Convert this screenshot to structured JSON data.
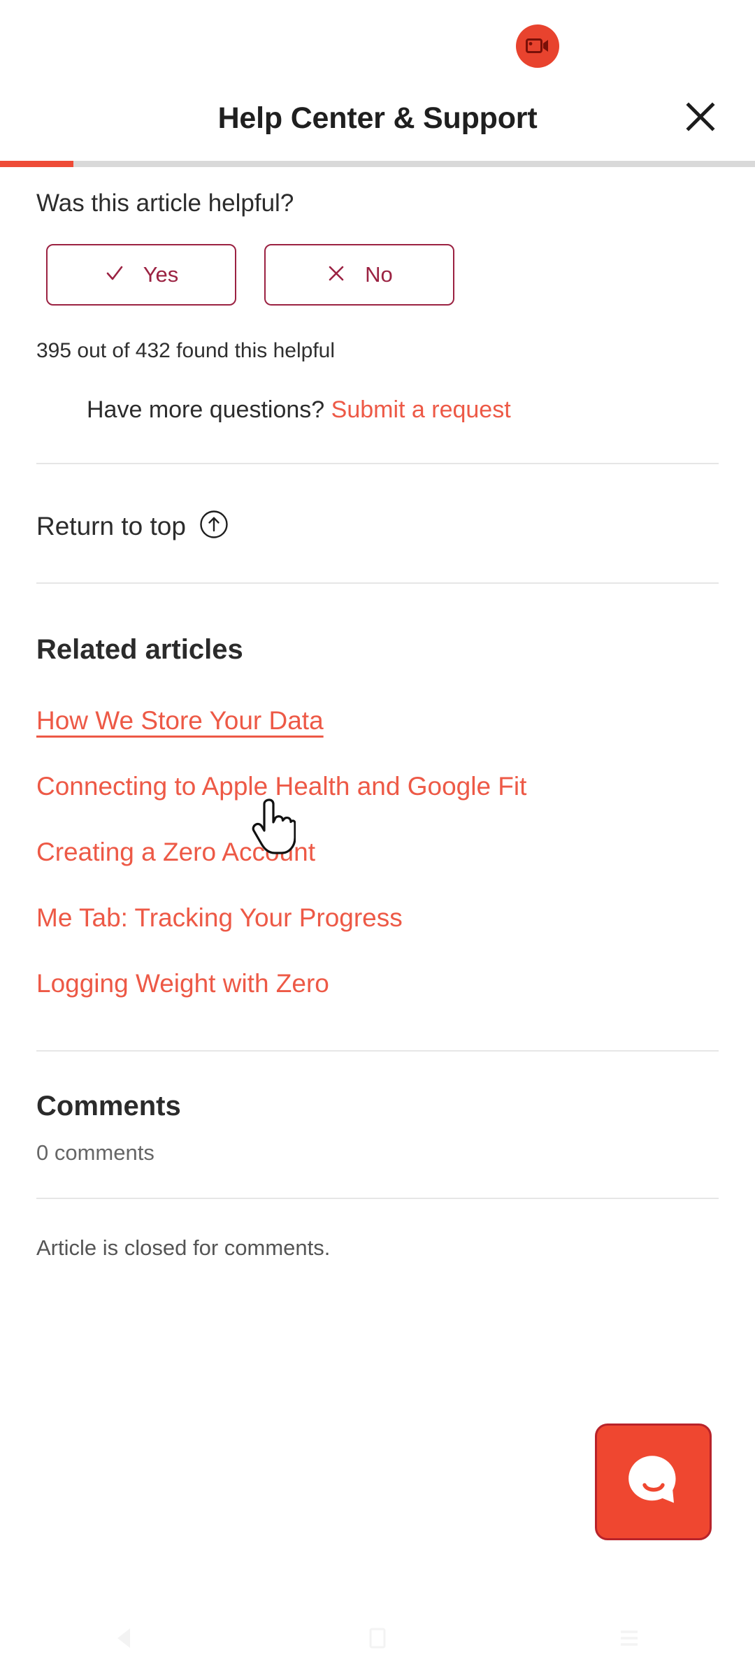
{
  "status": {
    "recording_badge_icon": "video-camera-icon",
    "recording_badge_color": "#e8432e"
  },
  "header": {
    "title": "Help Center & Support",
    "close_icon": "close-icon"
  },
  "progress": {
    "percent": 10,
    "fill_color": "#ee4b37",
    "track_color": "#d9d9d9"
  },
  "feedback": {
    "question": "Was this article helpful?",
    "yes": {
      "label": "Yes",
      "icon": "check-icon"
    },
    "no": {
      "label": "No",
      "icon": "x-icon"
    },
    "count_text": "395 out of 432 found this helpful",
    "helpful_yes": 395,
    "helpful_total": 432,
    "accent_color": "#9b2242"
  },
  "more_questions": {
    "prompt": "Have more questions?",
    "link_label": "Submit a request",
    "link_color": "#ed5946"
  },
  "return_to_top": {
    "label": "Return to top",
    "icon": "arrow-up-circle-icon"
  },
  "related": {
    "heading": "Related articles",
    "articles": [
      {
        "title": "How We Store Your Data",
        "hovered": true
      },
      {
        "title": "Connecting to Apple Health and Google Fit",
        "hovered": false
      },
      {
        "title": "Creating a Zero Account",
        "hovered": false
      },
      {
        "title": "Me Tab: Tracking Your Progress",
        "hovered": false
      },
      {
        "title": "Logging Weight with Zero",
        "hovered": false
      }
    ],
    "link_color": "#ed5946"
  },
  "comments": {
    "heading": "Comments",
    "count_text": "0 comments",
    "count": 0,
    "closed_note": "Article is closed for comments."
  },
  "chat_widget": {
    "icon": "chat-smile-icon",
    "background_color": "#ef4730",
    "border_color": "#b8232a"
  },
  "navbar": {
    "back_icon": "triangle-back-icon",
    "home_icon": "square-home-icon",
    "recents_icon": "menu-recents-icon"
  },
  "cursor": {
    "type": "pointing-hand-cursor"
  }
}
